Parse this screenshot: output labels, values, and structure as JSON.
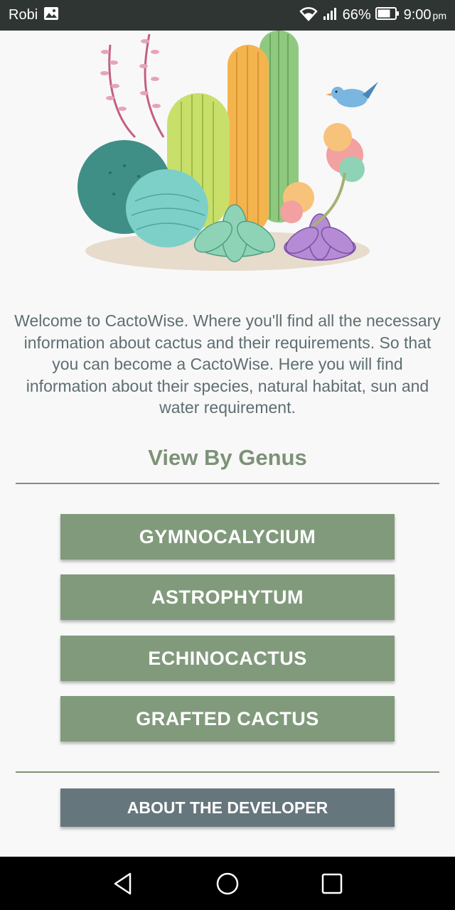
{
  "status_bar": {
    "carrier": "Robi",
    "battery": "66%",
    "time": "9:00",
    "ampm": "pm",
    "icons": [
      "image-icon",
      "wifi-icon",
      "signal-icon",
      "battery-icon"
    ]
  },
  "hero": {
    "image": "cactus-illustration"
  },
  "welcome_text": "Welcome to CactoWise. Where you'll find all the necessary information about cactus and their requirements. So that you can become a CactoWise. Here you will find information about their species, natural habitat, sun and water requirement.",
  "section_title": "View By Genus",
  "genus_buttons": [
    {
      "label": "GYMNOCALYCIUM"
    },
    {
      "label": "ASTROPHYTUM"
    },
    {
      "label": "ECHINOCACTUS"
    },
    {
      "label": "GRAFTED CACTUS"
    }
  ],
  "about_button": "ABOUT THE DEVELOPER",
  "nav": [
    "back-icon",
    "home-icon",
    "recents-icon"
  ],
  "colors": {
    "status_bar": "#2f3532",
    "genus_button": "#819a7c",
    "about_button": "#66767d",
    "title": "#7d9277",
    "body_text": "#5e6e72"
  }
}
